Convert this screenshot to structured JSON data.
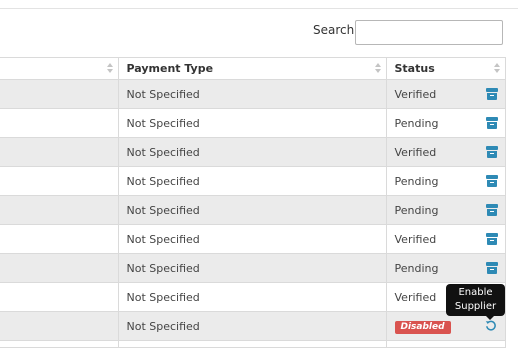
{
  "search": {
    "label": "Search:",
    "value": "",
    "placeholder": ""
  },
  "table": {
    "columns": [
      "",
      "Payment Type",
      "Status"
    ],
    "rows": [
      {
        "payment_type": "Not Specified",
        "status": "Verified"
      },
      {
        "payment_type": "Not Specified",
        "status": "Pending"
      },
      {
        "payment_type": "Not Specified",
        "status": "Verified"
      },
      {
        "payment_type": "Not Specified",
        "status": "Pending"
      },
      {
        "payment_type": "Not Specified",
        "status": "Pending"
      },
      {
        "payment_type": "Not Specified",
        "status": "Verified"
      },
      {
        "payment_type": "Not Specified",
        "status": "Pending"
      },
      {
        "payment_type": "Not Specified",
        "status": "Verified"
      },
      {
        "payment_type": "Not Specified",
        "status": "Disabled"
      }
    ]
  },
  "tooltip": {
    "line1": "Enable",
    "line2": "Supplier"
  },
  "icons": {
    "row_action": "archive-icon",
    "restore_action": "restore-icon",
    "sort": "sort-icon"
  },
  "colors": {
    "action_blue": "#2e8ab5",
    "badge_red": "#d9534f",
    "striped_row": "#ebebeb"
  }
}
